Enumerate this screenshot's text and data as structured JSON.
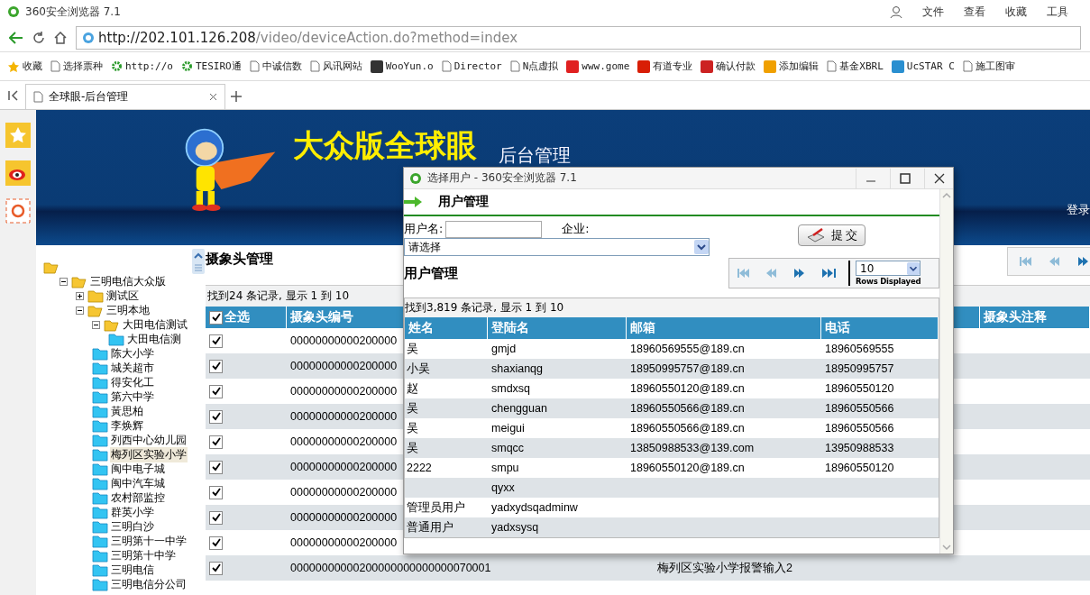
{
  "browser": {
    "title": "360安全浏览器 7.1",
    "menu": [
      "文件",
      "查看",
      "收藏",
      "工具"
    ],
    "url": {
      "host": "http://202.101.126.208",
      "path": "/video/deviceAction.do?method=index"
    },
    "bookmarks": [
      {
        "label": "收藏",
        "kind": "star"
      },
      {
        "label": "选择票种",
        "kind": "page"
      },
      {
        "label": "http://o",
        "kind": "gear"
      },
      {
        "label": "TESIRO通",
        "kind": "gear"
      },
      {
        "label": "中诚信数",
        "kind": "page"
      },
      {
        "label": "风讯网站",
        "kind": "page"
      },
      {
        "label": "WooYun.o",
        "kind": "square",
        "color": "#333333"
      },
      {
        "label": "Director",
        "kind": "page"
      },
      {
        "label": "N点虚拟",
        "kind": "page"
      },
      {
        "label": "www.gome",
        "kind": "square",
        "color": "#e02020"
      },
      {
        "label": "有道专业",
        "kind": "square",
        "color": "#d81e06"
      },
      {
        "label": "确认付款",
        "kind": "square",
        "color": "#cc2222"
      },
      {
        "label": "添加编辑",
        "kind": "square",
        "color": "#f0a000"
      },
      {
        "label": "基金XBRL",
        "kind": "page"
      },
      {
        "label": "UcSTAR C",
        "kind": "square",
        "color": "#2a8fd0"
      },
      {
        "label": "施工图审",
        "kind": "page"
      }
    ],
    "tab": {
      "title": "全球眼-后台管理"
    }
  },
  "banner": {
    "title": "大众版全球眼",
    "subtitle": "后台管理",
    "login": "登录"
  },
  "tree": [
    {
      "expanded": true,
      "children": [
        {
          "label": "三明电信大众版",
          "expanded": true,
          "selected": false,
          "children": [
            {
              "label": "测试区",
              "expanded": false,
              "selected": false
            },
            {
              "label": "三明本地",
              "expanded": true,
              "selected": false,
              "children": [
                {
                  "label": "大田电信测试",
                  "expanded": true,
                  "selected": false,
                  "children": [
                    {
                      "label": "大田电信测",
                      "selected": false
                    }
                  ]
                },
                {
                  "label": "陈大小学",
                  "selected": false
                },
                {
                  "label": "城关超市",
                  "selected": false
                },
                {
                  "label": "得安化工",
                  "selected": false
                },
                {
                  "label": "第六中学",
                  "selected": false
                },
                {
                  "label": "黃思柏",
                  "selected": false
                },
                {
                  "label": "李焕辉",
                  "selected": false
                },
                {
                  "label": "列西中心幼儿园",
                  "selected": false
                },
                {
                  "label": "梅列区实验小学",
                  "selected": true
                },
                {
                  "label": "闽中电子城",
                  "selected": false
                },
                {
                  "label": "闽中汽车城",
                  "selected": false
                },
                {
                  "label": "农村部监控",
                  "selected": false
                },
                {
                  "label": "群英小学",
                  "selected": false
                },
                {
                  "label": "三明白沙",
                  "selected": false
                },
                {
                  "label": "三明第十一中学",
                  "selected": false
                },
                {
                  "label": "三明第十中学",
                  "selected": false
                },
                {
                  "label": "三明电信",
                  "selected": false
                },
                {
                  "label": "三明电信分公司",
                  "selected": false
                }
              ]
            }
          ]
        }
      ]
    }
  ],
  "cameras": {
    "heading": "摄象头管理",
    "pager": [
      {
        "kind": "first",
        "disabled": true
      },
      {
        "kind": "prev",
        "disabled": true
      },
      {
        "kind": "next",
        "disabled": false
      }
    ],
    "count": "找到24 条记录, 显示  1 到  10",
    "select_all": {
      "label": "全选",
      "checked": true
    },
    "columns": [
      "摄象头编号",
      "摄象头注释"
    ],
    "rows": [
      {
        "checked": true,
        "id": "00000000000200000"
      },
      {
        "checked": true,
        "id": "00000000000200000"
      },
      {
        "checked": true,
        "id": "00000000000200000"
      },
      {
        "checked": true,
        "id": "00000000000200000"
      },
      {
        "checked": true,
        "id": "00000000000200000"
      },
      {
        "checked": true,
        "id": "00000000000200000"
      },
      {
        "checked": true,
        "id": "00000000000200000"
      },
      {
        "checked": true,
        "id": "00000000000200000"
      },
      {
        "checked": true,
        "id": "00000000000200000"
      },
      {
        "checked": true,
        "id": "00000000000200000000000000070001",
        "name": "梅列区实验小学报警输入2"
      }
    ]
  },
  "popup": {
    "title": "选择用户 - 360安全浏览器 7.1",
    "heading": "用户管理",
    "username_label": "用户名:",
    "company_label": "企业:",
    "company_select": "请选择",
    "submit": "提 交",
    "subheading": "用户管理",
    "pager": [
      {
        "kind": "first",
        "disabled": true
      },
      {
        "kind": "prev",
        "disabled": true
      },
      {
        "kind": "next",
        "disabled": false
      },
      {
        "kind": "last",
        "disabled": false
      }
    ],
    "rows_select": "10",
    "rows_label": "Rows Displayed",
    "count": "找到3,819 条记录, 显示  1 到  10",
    "columns": [
      "姓名",
      "登陆名",
      "邮箱",
      "电话"
    ],
    "rows": [
      {
        "name": "吴",
        "login": "gmjd",
        "email": "18960569555@189.cn",
        "phone": "18960569555"
      },
      {
        "name": "小吴",
        "login": "shaxianqg",
        "email": "18950995757@189.cn",
        "phone": "18950995757"
      },
      {
        "name": "赵",
        "login": "smdxsq",
        "email": "18960550120@189.cn",
        "phone": "18960550120"
      },
      {
        "name": "吴",
        "login": "chengguan",
        "email": "18960550566@189.cn",
        "phone": "18960550566"
      },
      {
        "name": "吴",
        "login": "meigui",
        "email": "18960550566@189.cn",
        "phone": "18960550566"
      },
      {
        "name": "吴",
        "login": "smqcc",
        "email": "13850988533@139.com",
        "phone": "13950988533"
      },
      {
        "name": "2222",
        "login": "smpu",
        "email": "18960550120@189.cn",
        "phone": "18960550120"
      },
      {
        "login": "qyxx"
      },
      {
        "name": "管理员用户",
        "login": "yadxydsqadminw"
      },
      {
        "name": "普通用户",
        "login": "yadxsysq"
      }
    ]
  }
}
